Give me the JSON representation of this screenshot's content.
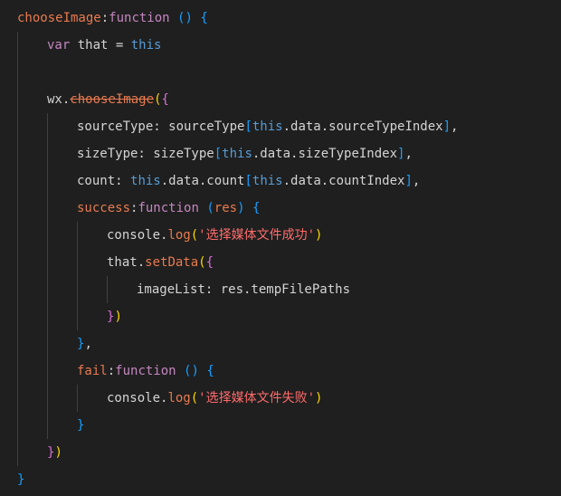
{
  "editor": {
    "theme_colors": {
      "background": "#1f1f1f",
      "keyword": "#c586c0",
      "this": "#569cd6",
      "function_name": "#e87a4f",
      "string": "#ff6b6b",
      "plain": "#d4d4d4",
      "bracket_level1": "#ffd700",
      "bracket_level2": "#da70d6",
      "bracket_level3": "#179fff",
      "indent_guide": "#404040"
    },
    "lines": [
      [
        {
          "text": "chooseImage",
          "type": "fn"
        },
        {
          "text": ":",
          "type": "punct"
        },
        {
          "text": "function",
          "type": "kw"
        },
        {
          "text": " ",
          "type": "punct"
        },
        {
          "text": "()",
          "type": "brace3"
        },
        {
          "text": " ",
          "type": "punct"
        },
        {
          "text": "{",
          "type": "brace3"
        }
      ],
      [
        {
          "text": "var",
          "type": "kw"
        },
        {
          "text": " that = ",
          "type": "var"
        },
        {
          "text": "this",
          "type": "this"
        }
      ],
      [],
      [
        {
          "text": "wx.",
          "type": "var"
        },
        {
          "text": "chooseImage",
          "type": "strike"
        },
        {
          "text": "(",
          "type": "brace1"
        },
        {
          "text": "{",
          "type": "brace2"
        }
      ],
      [
        {
          "text": "sourceType: sourceType",
          "type": "prop"
        },
        {
          "text": "[",
          "type": "brace3"
        },
        {
          "text": "this",
          "type": "this"
        },
        {
          "text": ".data.sourceTypeIndex",
          "type": "prop"
        },
        {
          "text": "]",
          "type": "brace3"
        },
        {
          "text": ",",
          "type": "punct"
        }
      ],
      [
        {
          "text": "sizeType: sizeType",
          "type": "prop"
        },
        {
          "text": "[",
          "type": "brace3"
        },
        {
          "text": "this",
          "type": "this"
        },
        {
          "text": ".data.sizeTypeIndex",
          "type": "prop"
        },
        {
          "text": "]",
          "type": "brace3"
        },
        {
          "text": ",",
          "type": "punct"
        }
      ],
      [
        {
          "text": "count: ",
          "type": "prop"
        },
        {
          "text": "this",
          "type": "this"
        },
        {
          "text": ".data.count",
          "type": "prop"
        },
        {
          "text": "[",
          "type": "brace3"
        },
        {
          "text": "this",
          "type": "this"
        },
        {
          "text": ".data.countIndex",
          "type": "prop"
        },
        {
          "text": "]",
          "type": "brace3"
        },
        {
          "text": ",",
          "type": "punct"
        }
      ],
      [
        {
          "text": "success",
          "type": "fn"
        },
        {
          "text": ":",
          "type": "punct"
        },
        {
          "text": "function",
          "type": "kw"
        },
        {
          "text": " ",
          "type": "punct"
        },
        {
          "text": "(",
          "type": "brace3"
        },
        {
          "text": "res",
          "type": "param"
        },
        {
          "text": ")",
          "type": "brace3"
        },
        {
          "text": " ",
          "type": "punct"
        },
        {
          "text": "{",
          "type": "brace3"
        }
      ],
      [
        {
          "text": "console.",
          "type": "var"
        },
        {
          "text": "log",
          "type": "method"
        },
        {
          "text": "(",
          "type": "brace1"
        },
        {
          "text": "'选择媒体文件成功'",
          "type": "str"
        },
        {
          "text": ")",
          "type": "brace1"
        }
      ],
      [
        {
          "text": "that.",
          "type": "var"
        },
        {
          "text": "setData",
          "type": "method"
        },
        {
          "text": "(",
          "type": "brace1"
        },
        {
          "text": "{",
          "type": "brace2"
        }
      ],
      [
        {
          "text": "imageList: res.tempFilePaths",
          "type": "prop"
        }
      ],
      [
        {
          "text": "}",
          "type": "brace2"
        },
        {
          "text": ")",
          "type": "brace1"
        }
      ],
      [
        {
          "text": "}",
          "type": "brace3"
        },
        {
          "text": ",",
          "type": "punct"
        }
      ],
      [
        {
          "text": "fail",
          "type": "fn"
        },
        {
          "text": ":",
          "type": "punct"
        },
        {
          "text": "function",
          "type": "kw"
        },
        {
          "text": " ",
          "type": "punct"
        },
        {
          "text": "()",
          "type": "brace3"
        },
        {
          "text": " ",
          "type": "punct"
        },
        {
          "text": "{",
          "type": "brace3"
        }
      ],
      [
        {
          "text": "console.",
          "type": "var"
        },
        {
          "text": "log",
          "type": "method"
        },
        {
          "text": "(",
          "type": "brace1"
        },
        {
          "text": "'选择媒体文件失败'",
          "type": "str"
        },
        {
          "text": ")",
          "type": "brace1"
        }
      ],
      [
        {
          "text": "}",
          "type": "brace3"
        }
      ],
      [
        {
          "text": "}",
          "type": "brace2"
        },
        {
          "text": ")",
          "type": "brace1"
        }
      ],
      [
        {
          "text": "}",
          "type": "brace3"
        }
      ]
    ]
  }
}
